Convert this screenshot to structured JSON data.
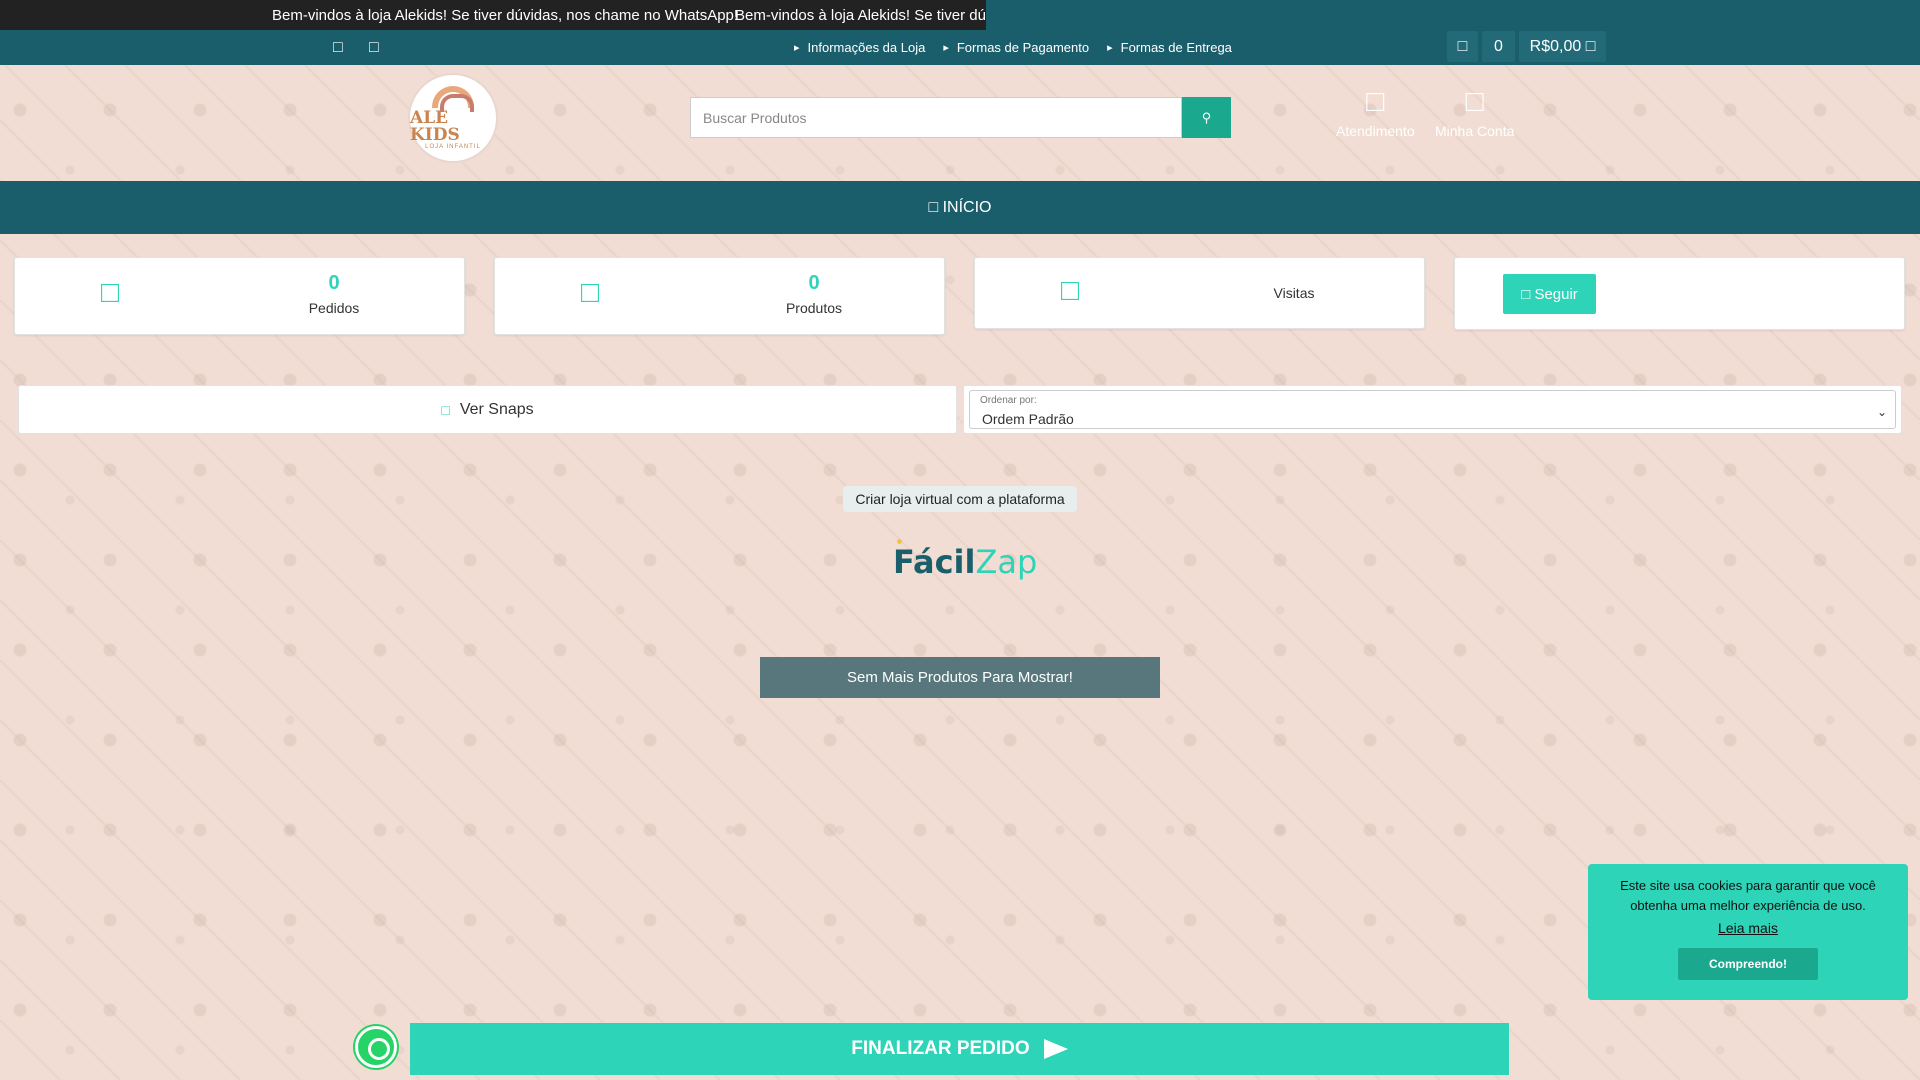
{
  "marquee": {
    "message_1": "Bem-vindos à loja Alekids! Se tiver dúvidas, nos chame no WhatsApp!",
    "message_2": "Bem-vindos à loja Alekids! Se tiver dúvid"
  },
  "topnav": {
    "links": [
      {
        "icon": "info-icon",
        "label": "Informações da Loja"
      },
      {
        "icon": "credit-card-icon",
        "label": "Formas de Pagamento"
      },
      {
        "icon": "truck-icon",
        "label": "Formas de Entrega"
      }
    ],
    "cart_count": "0",
    "cart_total": "R$0,00"
  },
  "header": {
    "logo_text": "ALE KIDS",
    "logo_sub": "LOJA INFANTIL",
    "search_placeholder": "Buscar Produtos",
    "atendimento_label": "Atendimento",
    "account_label": "Minha Conta"
  },
  "menu": {
    "home_label": "INÍCIO"
  },
  "stats": {
    "orders": {
      "value": "0",
      "label": "Pedidos"
    },
    "products": {
      "value": "0",
      "label": "Produtos"
    },
    "visits": {
      "label": "Visitas"
    },
    "follow_label": "Seguir"
  },
  "toolbar": {
    "snaps_label": "Ver Snaps",
    "sort_label": "Ordenar por:",
    "sort_value": "Ordem Padrão"
  },
  "platform": {
    "pill": "Criar loja virtual com a plataforma",
    "brand_part1": "Fácil",
    "brand_part2": "Zap"
  },
  "status": {
    "no_more": "Sem Mais Produtos Para Mostrar!"
  },
  "cookie": {
    "text": "Este site usa cookies para garantir que você obtenha uma melhor experiência de uso.",
    "link": "Leia mais",
    "button": "Compreendo!"
  },
  "bottom": {
    "finalize_label": "FINALIZAR PEDIDO"
  },
  "colors": {
    "primary": "#1b5e6b",
    "accent": "#2dd4b8",
    "background": "#f1ddd3"
  }
}
